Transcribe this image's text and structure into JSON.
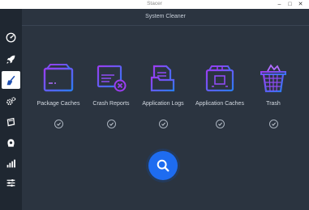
{
  "window": {
    "title": "Stacer",
    "controls": [
      "–",
      "□",
      "✕"
    ]
  },
  "sidebar": {
    "items": [
      {
        "name": "dashboard",
        "icon": "speedometer-icon",
        "active": false
      },
      {
        "name": "startup-apps",
        "icon": "rocket-icon",
        "active": false
      },
      {
        "name": "system-cleaner",
        "icon": "broom-icon",
        "active": true
      },
      {
        "name": "services",
        "icon": "gears-icon",
        "active": false
      },
      {
        "name": "uninstaller",
        "icon": "package-icon",
        "active": false
      },
      {
        "name": "apt-repository",
        "icon": "box-icon",
        "active": false
      },
      {
        "name": "resources",
        "icon": "bar-chart-icon",
        "active": false
      },
      {
        "name": "settings",
        "icon": "sliders-icon",
        "active": false
      }
    ]
  },
  "main": {
    "title": "System Cleaner",
    "categories": [
      {
        "label": "Package Caches",
        "icon": "package-box-icon",
        "checked": true
      },
      {
        "label": "Crash Reports",
        "icon": "crash-report-icon",
        "checked": true
      },
      {
        "label": "Application Logs",
        "icon": "logs-folder-icon",
        "checked": true
      },
      {
        "label": "Application Caches",
        "icon": "app-cache-box-icon",
        "checked": true
      },
      {
        "label": "Trash",
        "icon": "trash-basket-icon",
        "checked": true
      }
    ],
    "scan_button": {
      "icon": "search-icon"
    }
  },
  "colors": {
    "sidebar_bg": "#1f2731",
    "main_bg": "#2b3440",
    "icon_purple": "#8a3cf0",
    "icon_blue": "#2a7cf5",
    "scan_blue": "#1e6cf0"
  }
}
